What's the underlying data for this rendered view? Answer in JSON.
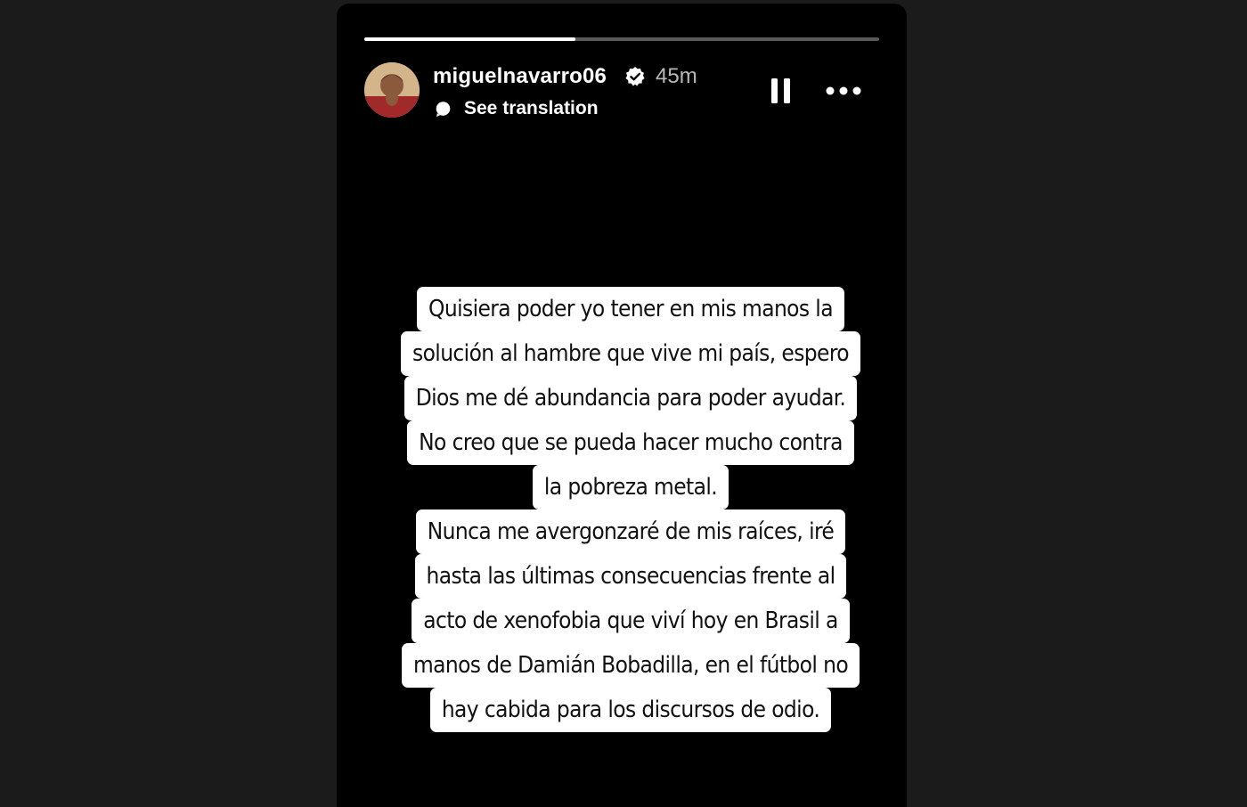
{
  "story": {
    "progress_percent": 41,
    "username": "miguelnavarro06",
    "verified": true,
    "timestamp": "45m",
    "translation_label": "See translation",
    "caption_lines": [
      "Quisiera poder yo tener en mis manos la",
      "solución al hambre que vive mi país, espero",
      "Dios me dé abundancia para poder ayudar.",
      "No creo que se pueda hacer mucho contra",
      "la pobreza metal.",
      "Nunca me avergonzaré de mis raíces, iré",
      "hasta las últimas consecuencias frente al",
      "acto de xenofobia que viví hoy en Brasil a",
      "manos de Damián Bobadilla, en el fútbol no",
      "hay cabida para los discursos de odio."
    ]
  },
  "icons": {
    "verified": "verified-badge-icon",
    "translation": "speech-bubble-icon",
    "pause": "pause-icon",
    "more": "more-horizontal-icon"
  },
  "colors": {
    "page_background": "#1b1b1b",
    "story_background": "#000000",
    "text_primary": "#ffffff",
    "text_secondary": "#b8b8b8",
    "caption_background": "#ffffff",
    "caption_text": "#111111"
  }
}
